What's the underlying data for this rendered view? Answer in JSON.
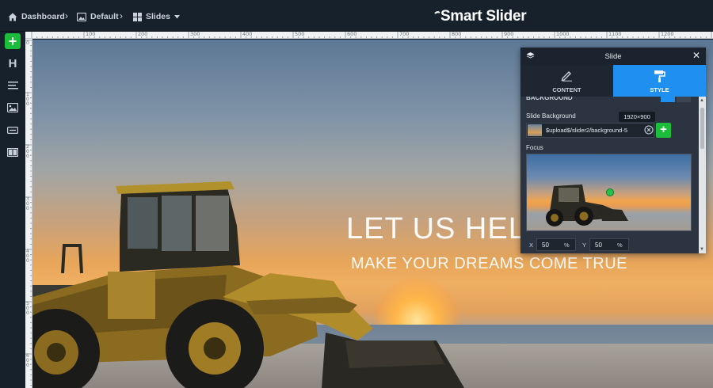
{
  "breadcrumb": {
    "items": [
      {
        "label": "Dashboard",
        "icon": "home-icon"
      },
      {
        "label": "Default",
        "icon": "image-icon"
      },
      {
        "label": "Slides",
        "icon": "grid-icon"
      }
    ],
    "separator": "›"
  },
  "logo": {
    "text": "Smart Slider"
  },
  "left_toolbar": {
    "items": [
      "add-icon",
      "heading-icon",
      "text-icon",
      "image-icon",
      "button-icon",
      "row-icon"
    ],
    "add_label": "+",
    "heading_label": "H"
  },
  "ruler": {
    "top_labels": [
      "100",
      "200",
      "300",
      "400",
      "500",
      "600",
      "700",
      "800",
      "900",
      "1000",
      "1100",
      "1200"
    ],
    "left_labels": [
      "0",
      "1 0 0",
      "2 0 0",
      "3 0 0",
      "4 0 0",
      "5 0 0",
      "6 0 0"
    ]
  },
  "slide": {
    "headline": "LET US HEL",
    "subline": "MAKE YOUR DREAMS COME TRUE"
  },
  "panel": {
    "title": "Slide",
    "close_label": "✕",
    "tabs": [
      {
        "label": "CONTENT",
        "active": false
      },
      {
        "label": "STYLE",
        "active": true
      }
    ],
    "section_cut": "BACKGROUND",
    "background_label": "Slide Background",
    "resolution": "1920×900",
    "background_value": "$upload$/slider2/background-5",
    "add_label": "+",
    "focus_label": "Focus",
    "x_label": "X",
    "x_value": "50",
    "y_label": "Y",
    "y_value": "50",
    "unit": "%"
  },
  "colors": {
    "accent": "#1f8ff0",
    "green": "#1dbd3c",
    "panel_bg": "#2b3440",
    "topbar_bg": "#17212c"
  }
}
